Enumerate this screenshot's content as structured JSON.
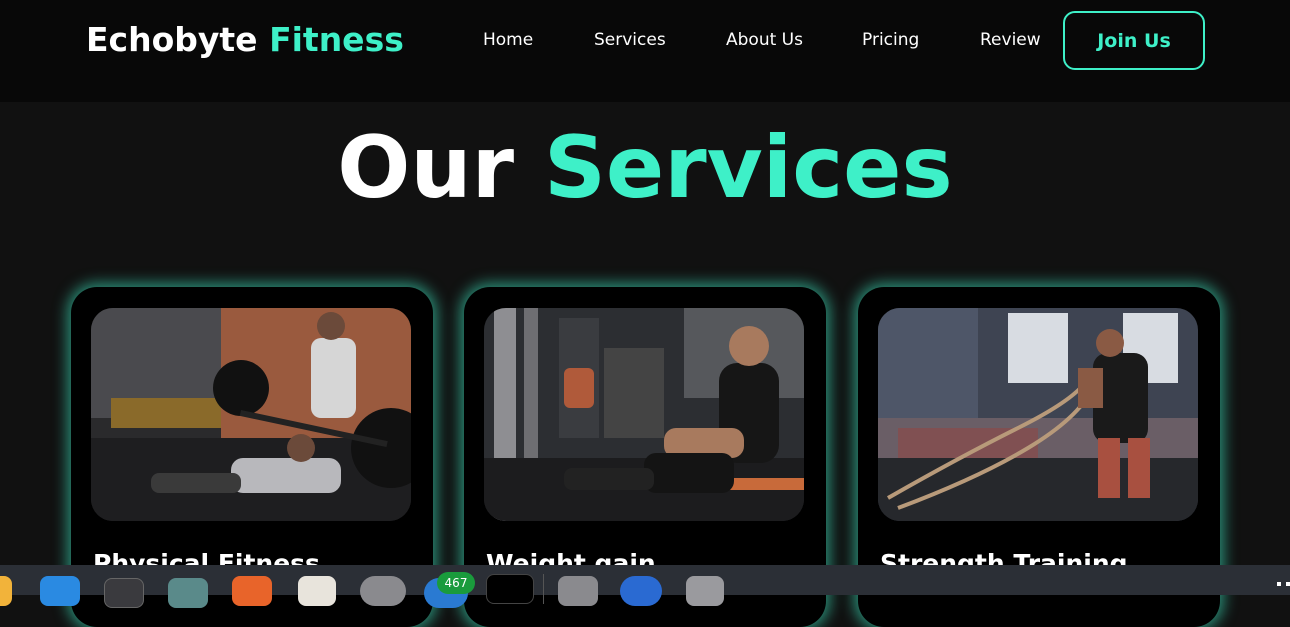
{
  "brand": {
    "name_main": "Echobyte",
    "name_accent": "Fitness"
  },
  "nav": {
    "items": [
      "Home",
      "Services",
      "About Us",
      "Pricing",
      "Review"
    ],
    "cta": "Join Us"
  },
  "section": {
    "title_main": "Our",
    "title_accent": "Services"
  },
  "cards": [
    {
      "title": "Physical Fitness",
      "image": "bench-press-photo"
    },
    {
      "title": "Weight gain",
      "image": "cable-row-photo"
    },
    {
      "title": "Strength Training",
      "image": "battle-ropes-photo"
    }
  ],
  "taskbar": {
    "badge_count": "467",
    "icons": [
      "vscode-icon",
      "terminal-icon",
      "files-icon",
      "app-store-icon",
      "text-editor-icon",
      "settings-icon",
      "chrome-icon",
      "notion-icon",
      "window-manager-icon",
      "thunderbird-icon",
      "disk-icon"
    ]
  },
  "colors": {
    "accent": "#3ef0c8",
    "background": "#111111",
    "navbar": "#080808",
    "card": "#000000"
  }
}
